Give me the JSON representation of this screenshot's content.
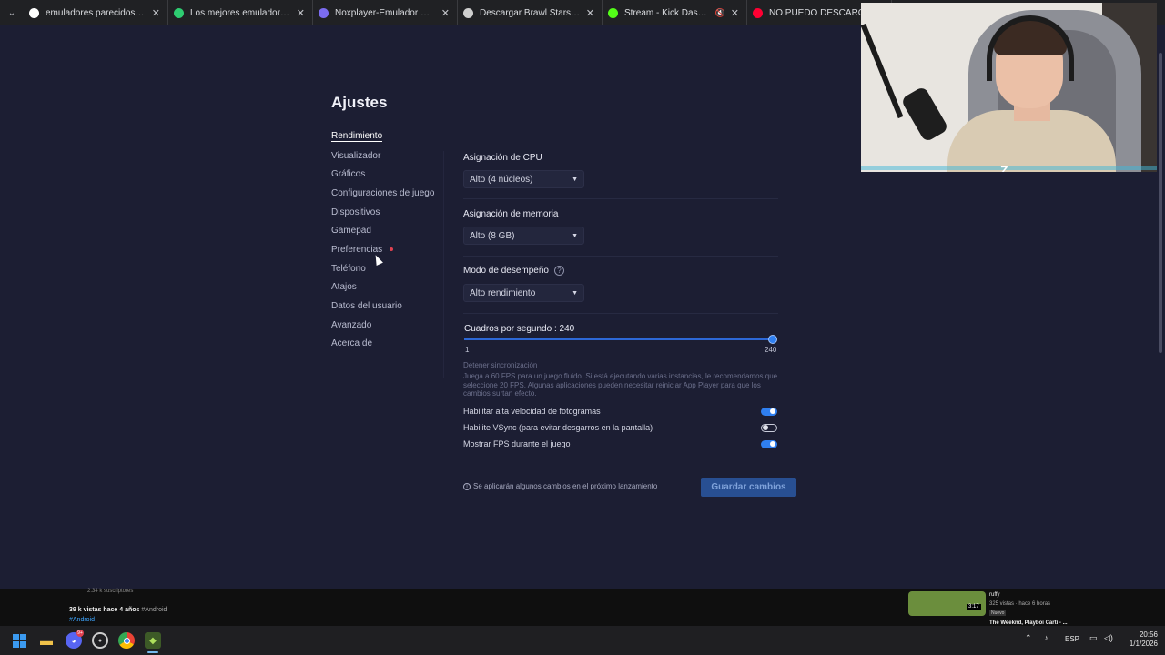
{
  "browser_tabs": [
    {
      "title": "emuladores parecidos a bluesta",
      "favicon": "google-icon",
      "fav_color": "#ffffff"
    },
    {
      "title": "Los mejores emuladores de An",
      "favicon": "x-icon",
      "fav_color": "#2ecc71"
    },
    {
      "title": "Noxplayer-Emulador más rápid",
      "favicon": "nox-icon",
      "fav_color": "#7b6cf0"
    },
    {
      "title": "Descargar Brawl Stars en PC co",
      "favicon": "globe-icon",
      "fav_color": "#cfcfcf"
    },
    {
      "title": "Stream - Kick Dashboard",
      "favicon": "kick-icon",
      "fav_color": "#53fc18"
    },
    {
      "title": "NO PUEDO DESCARGAR APL",
      "favicon": "youtube-icon",
      "fav_color": "#ff0033"
    }
  ],
  "settings": {
    "title": "Ajustes",
    "nav": [
      {
        "label": "Rendimiento",
        "active": true
      },
      {
        "label": "Visualizador"
      },
      {
        "label": "Gráficos"
      },
      {
        "label": "Configuraciones de juego"
      },
      {
        "label": "Dispositivos"
      },
      {
        "label": "Gamepad"
      },
      {
        "label": "Preferencias",
        "dot": true
      },
      {
        "label": "Teléfono"
      },
      {
        "label": "Atajos"
      },
      {
        "label": "Datos del usuario"
      },
      {
        "label": "Avanzado"
      },
      {
        "label": "Acerca de"
      }
    ],
    "cpu": {
      "label": "Asignación de CPU",
      "value": "Alto (4 núcleos)"
    },
    "memory": {
      "label": "Asignación de memoria",
      "value": "Alto (8 GB)"
    },
    "performance_mode": {
      "label": "Modo de desempeño",
      "value": "Alto rendimiento"
    },
    "fps": {
      "label": "Cuadros por segundo : 240",
      "min": "1",
      "max": "240",
      "value": 240,
      "min_value": 1,
      "max_value": 240
    },
    "sync": {
      "title": "Detener sincronización",
      "description": "Juega a 60 FPS para un juego fluido. Si está ejecutando varias instancias, le recomendamos que seleccione 20 FPS. Algunas aplicaciones pueden necesitar reiniciar App Player para que los cambios surtan efecto."
    },
    "toggles": [
      {
        "label": "Habilitar alta velocidad de fotogramas",
        "on": true
      },
      {
        "label": "Habilite VSync (para evitar desgarros en la pantalla)",
        "on": false
      },
      {
        "label": "Mostrar FPS durante el juego",
        "on": true
      }
    ],
    "notice": "Se aplicarán algunos cambios en el próximo lanzamiento",
    "save_label": "Guardar cambios"
  },
  "youtube": {
    "views": "39 k vistas",
    "age": "hace 4 años",
    "tag": "#Android",
    "hashtag": "#Android",
    "subs": "2.34 k suscriptores",
    "side_channel": "ruffy",
    "side_meta": "325 vistas · hace 6 horas",
    "side_badge": "Nuevo",
    "side_duration": "3:17",
    "side_next": "The Weeknd, Playboi Carti - ..."
  },
  "taskbar": {
    "discord_badge": "9+",
    "language": "ESP",
    "time": "20:56",
    "date": "1/1/2026"
  },
  "webcam": {
    "logo": "Z"
  },
  "colors": {
    "accent": "#2f7ff0",
    "background": "#1c1e33",
    "save_button": "#284f92"
  }
}
